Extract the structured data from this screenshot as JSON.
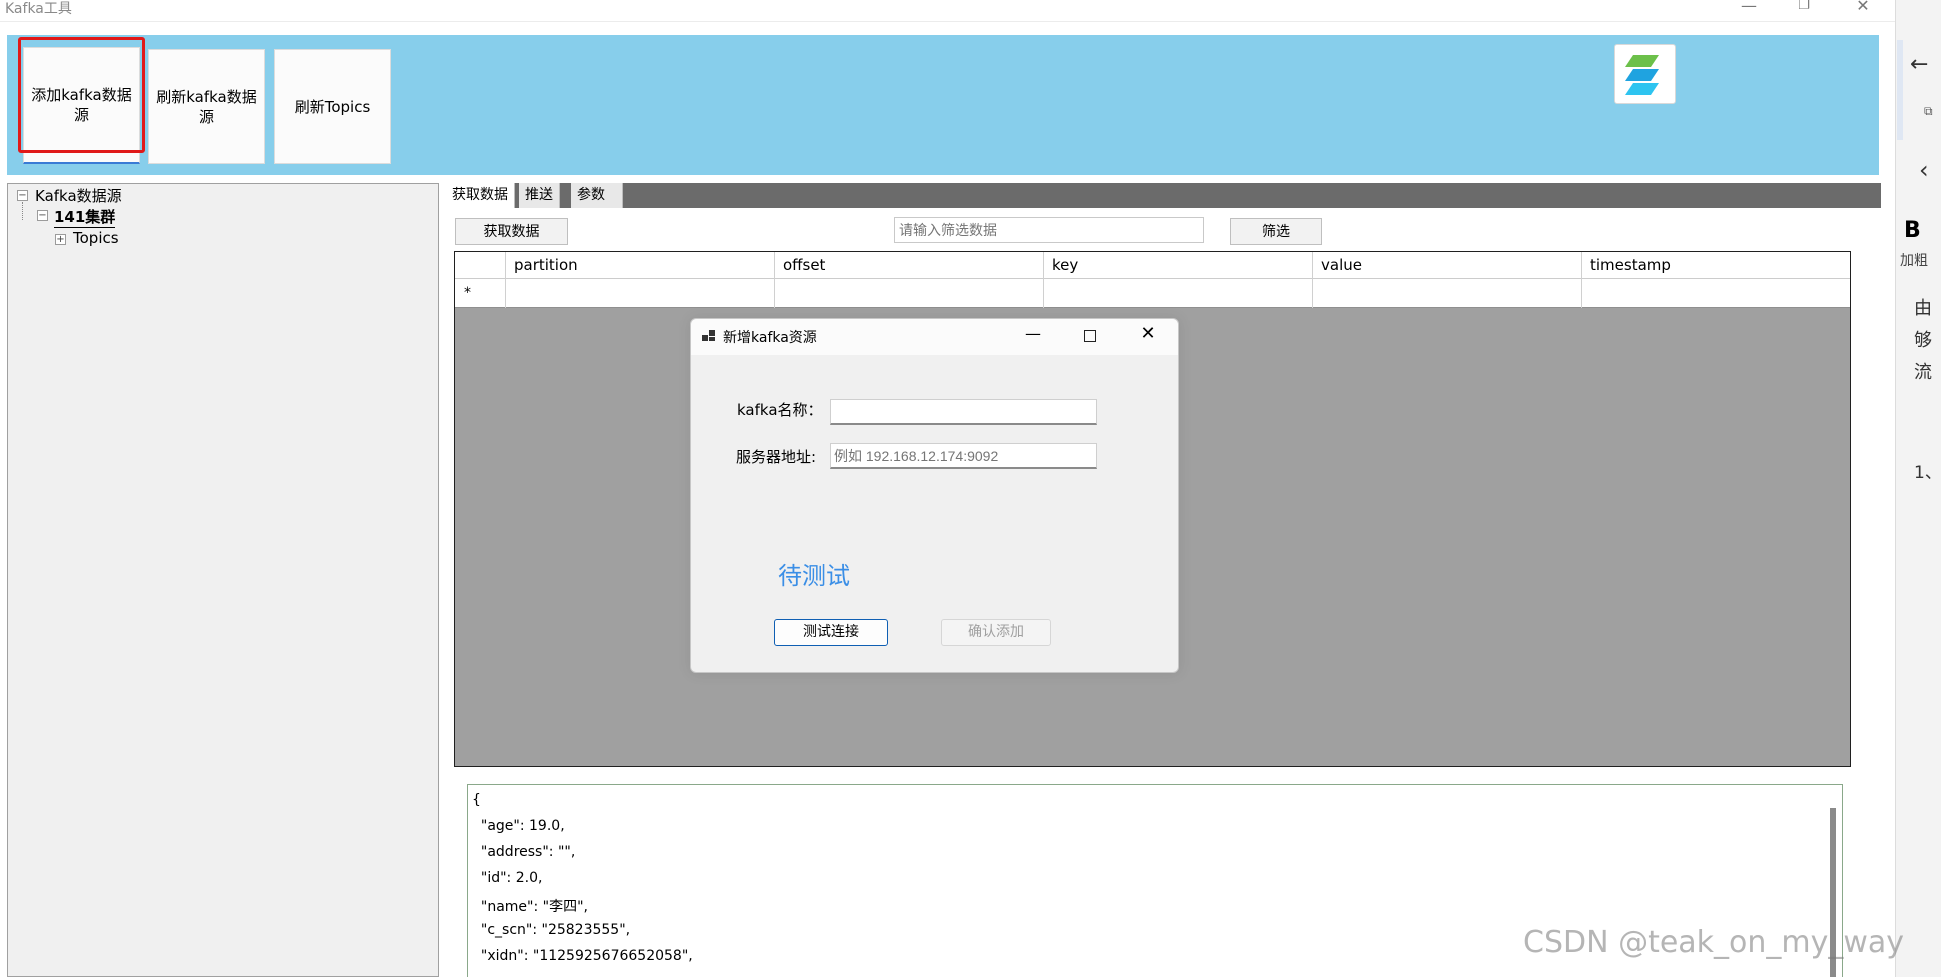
{
  "window": {
    "title": "Kafka工具",
    "controls": {
      "minimize": "—",
      "restore": "❐",
      "close": "✕"
    }
  },
  "toolbar": {
    "add_source_line1": "添加kafka数据",
    "add_source_line2": "源",
    "refresh_source_line1": "刷新kafka数据",
    "refresh_source_line2": "源",
    "refresh_topics": "刷新Topics",
    "background_color": "#87ceeb"
  },
  "tree": {
    "root": "Kafka数据源",
    "cluster": "141集群",
    "topics": "Topics",
    "collapse_glyph": "−",
    "expand_glyph": "+"
  },
  "tabs": [
    "获取数据",
    "推送",
    "参数"
  ],
  "actions": {
    "fetch_button": "获取数据",
    "filter_placeholder": "请输入筛选数据",
    "filter_button": "筛选"
  },
  "grid": {
    "columns": [
      "partition",
      "offset",
      "key",
      "value",
      "timestamp"
    ],
    "new_row_marker": "*"
  },
  "json_output": [
    "{",
    "  \"age\": 19.0,",
    "  \"address\": \"\",",
    "  \"id\": 2.0,",
    "  \"name\": \"李四\",",
    "  \"c_scn\": \"25823555\",",
    "  \"xidn\": \"1125925676652058\","
  ],
  "dialog": {
    "title": "新增kafka资源",
    "name_label": "kafka名称：",
    "name_value": "",
    "address_label": "服务器地址:",
    "address_placeholder": "例如 192.168.12.174:9092",
    "status": "待测试",
    "test_button": "测试连接",
    "confirm_button": "确认添加",
    "status_color": "#3a8ee6"
  },
  "side_panel": {
    "bold_label": "B",
    "bold_caption": "加粗",
    "text_fragments": [
      "由",
      "够",
      "流",
      "1、"
    ]
  },
  "watermark": "CSDN @teak_on_my_way"
}
